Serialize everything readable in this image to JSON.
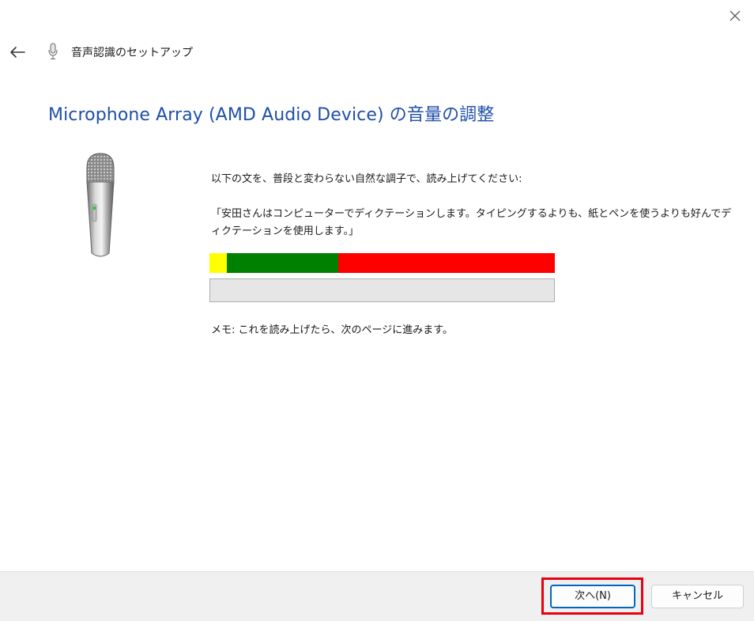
{
  "window": {
    "wizard_title": "音声認識のセットアップ",
    "close_icon": "close-icon",
    "back_icon": "back-arrow-icon"
  },
  "main": {
    "heading": "Microphone Array (AMD Audio Device) の音量の調整",
    "instruction": "以下の文を、普段と変わらない自然な調子で、読み上げてください:",
    "quote": "「安田さんはコンピューターでディクテーションします。タイピングするよりも、紙とペンを使うよりも好んでディクテーションを使用します。」",
    "note": "メモ: これを読み上げたら、次のページに進みます。",
    "level_colors": {
      "low": "#ffff00",
      "good": "#008000",
      "high": "#ff0000"
    },
    "meter_level_percent": 0
  },
  "footer": {
    "next_label": "次へ(N)",
    "cancel_label": "キャンセル",
    "highlight_color": "#e60012",
    "accent_color": "#0067c0"
  }
}
